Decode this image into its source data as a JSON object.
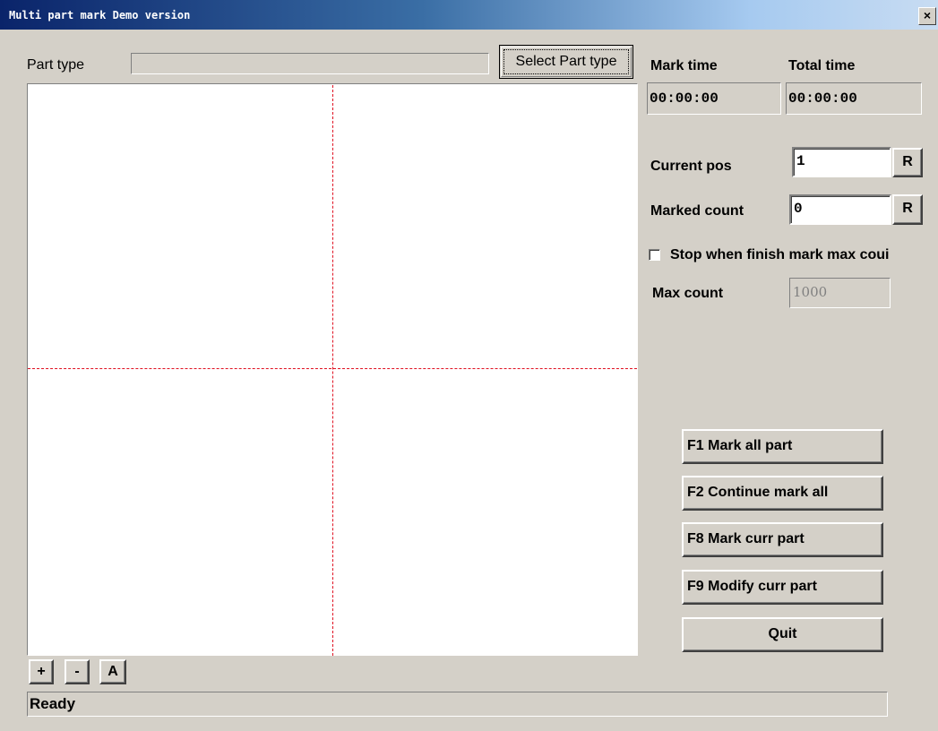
{
  "window": {
    "title": "Multi part mark Demo version",
    "close_label": "×"
  },
  "part_type": {
    "label": "Part type",
    "value": "",
    "select_button_label": "Select Part type"
  },
  "timing": {
    "mark_time_label": "Mark time",
    "mark_time_value": "00:00:00",
    "total_time_label": "Total time",
    "total_time_value": "00:00:00"
  },
  "position": {
    "current_pos_label": "Current pos",
    "current_pos_value": "1",
    "current_pos_reset_label": "R",
    "marked_count_label": "Marked count",
    "marked_count_value": "0",
    "marked_count_reset_label": "R"
  },
  "stop_option": {
    "label": "Stop when finish mark max coui",
    "checked": false,
    "max_count_label": "Max count",
    "max_count_value": "1000"
  },
  "actions": {
    "mark_all": "F1 Mark all part",
    "continue_mark_all": "F2 Continue mark all",
    "mark_curr": "F8 Mark curr part",
    "modify_curr": "F9 Modify curr part",
    "quit": "Quit"
  },
  "zoom": {
    "zoom_in": "+",
    "zoom_out": "-",
    "auto": "A"
  },
  "status": {
    "text": "Ready"
  },
  "colors": {
    "window_bg": "#d4d0c8",
    "crosshair": "#e01020",
    "titlebar_start": "#0a246a"
  }
}
